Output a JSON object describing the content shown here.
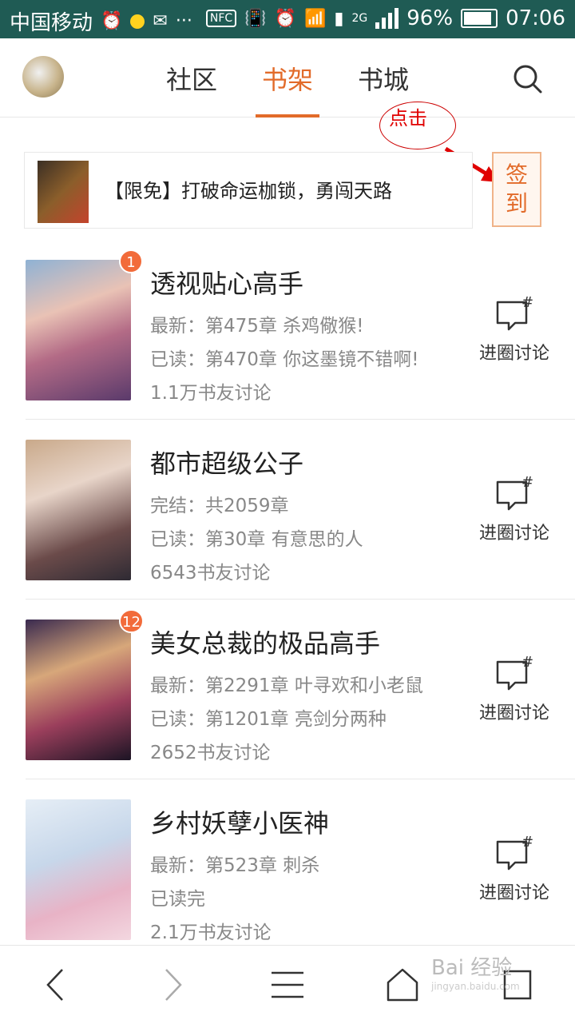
{
  "status_bar": {
    "carrier": "中国移动",
    "network": "2G",
    "battery": "96%",
    "time": "07:06",
    "nfc_label": "NFC"
  },
  "header": {
    "tabs": [
      {
        "label": "社区",
        "active": false
      },
      {
        "label": "书架",
        "active": true
      },
      {
        "label": "书城",
        "active": false
      }
    ]
  },
  "annotation": {
    "label": "点击"
  },
  "promo": {
    "text": "【限免】打破命运枷锁，勇闯天路"
  },
  "checkin": {
    "line1": "签",
    "line2": "到"
  },
  "books": [
    {
      "title": "透视贴心高手",
      "badge": "1",
      "line1": "最新：第475章 杀鸡儆猴!",
      "line2": "已读：第470章 你这墨镜不错啊!",
      "discussion": "1.1万书友讨论",
      "action": "进圈讨论"
    },
    {
      "title": "都市超级公子",
      "badge": "",
      "line1": "完结：共2059章",
      "line2": "已读：第30章 有意思的人",
      "discussion": "6543书友讨论",
      "action": "进圈讨论"
    },
    {
      "title": "美女总裁的极品高手",
      "badge": "12",
      "line1": "最新：第2291章 叶寻欢和小老鼠",
      "line2": "已读：第1201章 亮剑分两种",
      "discussion": "2652书友讨论",
      "action": "进圈讨论"
    },
    {
      "title": "乡村妖孽小医神",
      "badge": "",
      "line1": "最新：第523章 刺杀",
      "line2": "已读完",
      "discussion": "2.1万书友讨论",
      "action": "进圈讨论"
    }
  ],
  "watermark": {
    "text": "Bai 经验",
    "sub": "jingyan.baidu.com"
  },
  "colors": {
    "accent": "#e26b2a",
    "status_bar": "#1f5b54",
    "badge": "#f26b3a",
    "annotation": "#e00000"
  }
}
